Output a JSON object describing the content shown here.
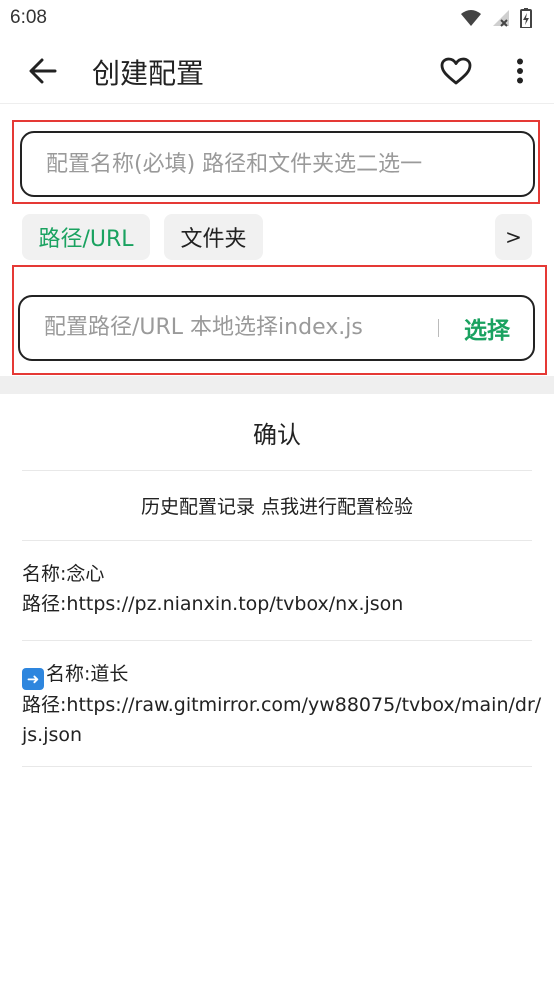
{
  "status_bar": {
    "time": "6:08",
    "icons": [
      "wifi-icon",
      "signal-icon",
      "battery-icon"
    ]
  },
  "app_bar": {
    "title": "创建配置",
    "back_icon": "arrow-left-icon",
    "favorite_icon": "heart-outline-icon",
    "more_icon": "more-vertical-icon"
  },
  "form": {
    "name_placeholder": "配置名称(必填) 路径和文件夹选二选一",
    "name_value": "",
    "chips": [
      {
        "label": "路径/URL",
        "active": true
      },
      {
        "label": "文件夹",
        "active": false
      }
    ],
    "next_label": ">",
    "path_placeholder": "配置路径/URL 本地选择index.js",
    "path_value": "",
    "select_label": "选择"
  },
  "actions": {
    "confirm_label": "确认",
    "history_label": "历史配置记录 点我进行配置检验"
  },
  "records": [
    {
      "name": "名称:念心",
      "path": "路径:https://pz.nianxin.top/tvbox/nx.json",
      "selected": false
    },
    {
      "name": "名称:道长",
      "path": "路径:https://raw.gitmirror.com/yw88075/tvbox/main/dr/js.json",
      "selected": true
    }
  ],
  "colors": {
    "accent": "#1aa260",
    "highlight": "#e53935",
    "text": "#222222",
    "placeholder": "#9a9a9a"
  }
}
